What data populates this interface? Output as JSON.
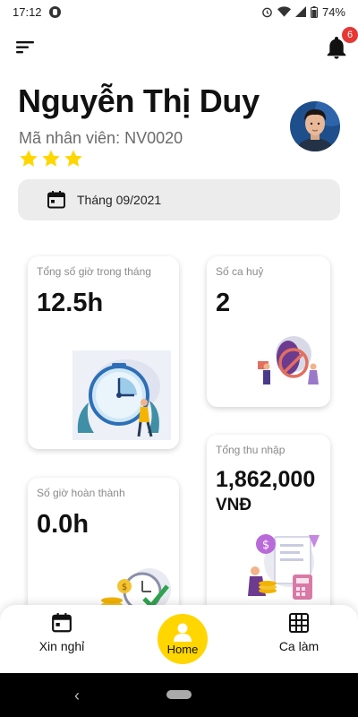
{
  "status_bar": {
    "time": "17:12",
    "battery": "74%"
  },
  "header": {
    "notification_count": "6"
  },
  "profile": {
    "name": "Nguyễn Thị Duy",
    "employee_id_label": "Mã nhân viên:",
    "employee_id": "NV0020",
    "rating": 3
  },
  "month_picker": {
    "value": "Tháng 09/2021"
  },
  "cards": {
    "total_hours": {
      "label": "Tổng số giờ trong tháng",
      "value": "12.5h"
    },
    "cancelled": {
      "label": "Số ca huỷ",
      "value": "2"
    },
    "completed_hours": {
      "label": "Số giờ hoàn thành",
      "value": "0.0h"
    },
    "income": {
      "label": "Tổng thu nhập",
      "value": "1,862,000",
      "unit": "VNĐ"
    }
  },
  "bottom_nav": {
    "leave_label": "Xin nghỉ",
    "home_label": "Home",
    "shifts_label": "Ca làm"
  },
  "colors": {
    "accent": "#ffd600",
    "star": "#ffd600",
    "badge": "#e53935",
    "card_bg": "#ffffff"
  }
}
